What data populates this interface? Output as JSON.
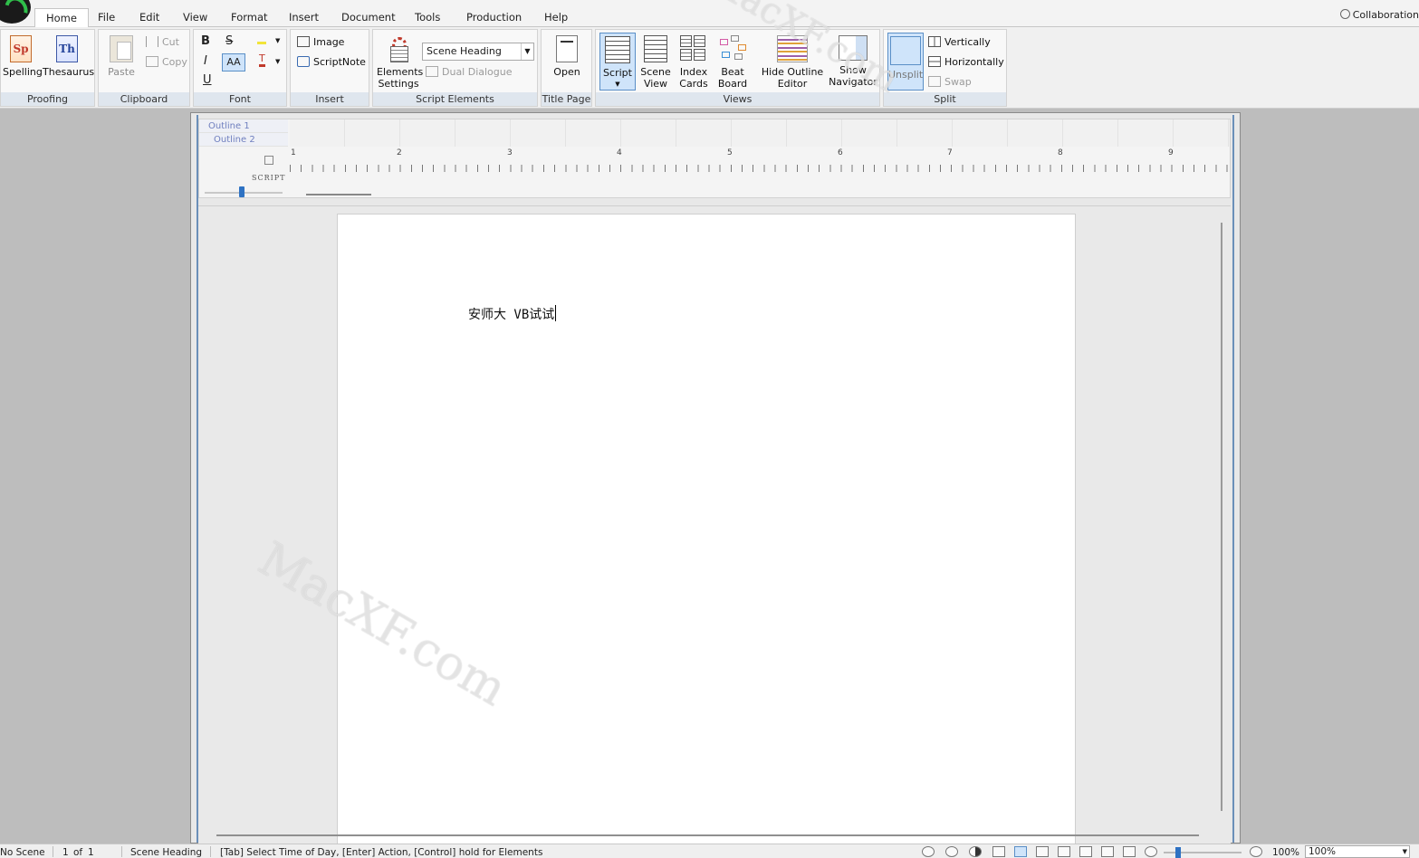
{
  "menu": {
    "tabs": [
      "Home",
      "File",
      "Edit",
      "View",
      "Format",
      "Insert",
      "Document",
      "Tools",
      "Production",
      "Help"
    ],
    "active_tab": "Home",
    "collaboration": "Collaboration"
  },
  "ribbon": {
    "proofing": {
      "label": "Proofing",
      "spelling": "Spelling",
      "spelling_icon_text": "Sp",
      "thesaurus": "Thesaurus",
      "thesaurus_icon_text": "Th"
    },
    "clipboard": {
      "label": "Clipboard",
      "paste": "Paste",
      "cut": "Cut",
      "copy": "Copy"
    },
    "font": {
      "label": "Font",
      "bold": "B",
      "strike": "S",
      "italic": "I",
      "caps": "AA",
      "underline": "U",
      "color": "T"
    },
    "insert": {
      "label": "Insert",
      "image": "Image",
      "scriptnote": "ScriptNote"
    },
    "script_elements": {
      "label": "Script Elements",
      "elements_settings_1": "Elements",
      "elements_settings_2": "Settings",
      "element_dropdown": "Scene Heading",
      "dual_dialogue": "Dual Dialogue"
    },
    "title_page": {
      "label": "Title Page",
      "open": "Open"
    },
    "views": {
      "label": "Views",
      "script": "Script",
      "scene_view_1": "Scene",
      "scene_view_2": "View",
      "index_cards_1": "Index",
      "index_cards_2": "Cards",
      "beat_board_1": "Beat",
      "beat_board_2": "Board",
      "hide_outline_1": "Hide Outline",
      "hide_outline_2": "Editor",
      "show_navigator_1": "Show",
      "show_navigator_2": "Navigator"
    },
    "split": {
      "label": "Split",
      "unsplit": "Unsplit",
      "vertically": "Vertically",
      "horizontally": "Horizontally",
      "swap": "Swap"
    }
  },
  "outline": {
    "row1": "Outline 1",
    "row2": "Outline 2",
    "script_label": "SCRIPT"
  },
  "ruler": {
    "numbers": [
      "1",
      "2",
      "3",
      "4",
      "5",
      "6",
      "7",
      "8",
      "9"
    ]
  },
  "document": {
    "text": "安师大 VB试试"
  },
  "status": {
    "scene": "No Scene",
    "page": "1",
    "of_label": "of",
    "page_total": "1",
    "element": "Scene Heading",
    "hint": "[Tab] Select Time of Day, [Enter] Action, [Control] hold for Elements",
    "zoom_label": "100%",
    "zoom_value": "100%"
  },
  "watermark": {
    "text": "MacXF.com"
  }
}
